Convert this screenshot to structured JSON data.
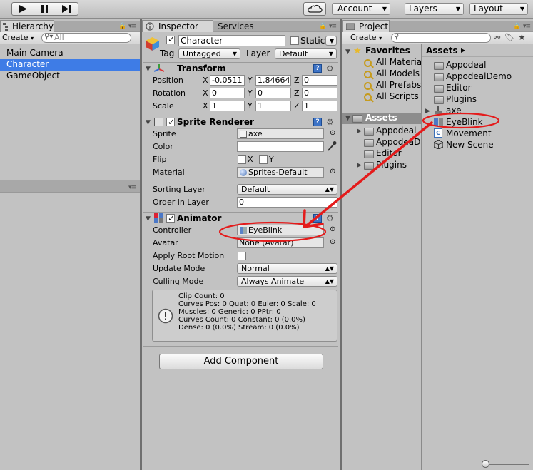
{
  "toolbar": {
    "account_label": "Account",
    "layers_label": "Layers",
    "layout_label": "Layout"
  },
  "hierarchy": {
    "tab_label": "Hierarchy",
    "create_label": "Create",
    "search_placeholder": "All",
    "items": [
      "Main Camera",
      "Character",
      "GameObject"
    ],
    "selected_index": 1
  },
  "inspector": {
    "tab_label": "Inspector",
    "services_tab_label": "Services",
    "object_name": "Character",
    "static_label": "Static",
    "tag_label": "Tag",
    "tag_value": "Untagged",
    "layer_label": "Layer",
    "layer_value": "Default",
    "transform": {
      "title": "Transform",
      "position_label": "Position",
      "rotation_label": "Rotation",
      "scale_label": "Scale",
      "x_label": "X",
      "y_label": "Y",
      "z_label": "Z",
      "position": [
        "-0.0511",
        "1.84664",
        "0"
      ],
      "rotation": [
        "0",
        "0",
        "0"
      ],
      "scale": [
        "1",
        "1",
        "1"
      ]
    },
    "sprite_renderer": {
      "title": "Sprite Renderer",
      "sprite_label": "Sprite",
      "sprite_value": "axe",
      "color_label": "Color",
      "flip_label": "Flip",
      "flip_x_label": "X",
      "flip_y_label": "Y",
      "material_label": "Material",
      "material_value": "Sprites-Default",
      "sorting_layer_label": "Sorting Layer",
      "sorting_layer_value": "Default",
      "order_label": "Order in Layer",
      "order_value": "0"
    },
    "animator": {
      "title": "Animator",
      "controller_label": "Controller",
      "controller_value": "EyeBlink",
      "avatar_label": "Avatar",
      "avatar_value": "None (Avatar)",
      "root_motion_label": "Apply Root Motion",
      "update_mode_label": "Update Mode",
      "update_mode_value": "Normal",
      "culling_mode_label": "Culling Mode",
      "culling_mode_value": "Always Animate",
      "info_lines": [
        "Clip Count: 0",
        "Curves Pos: 0 Quat: 0 Euler: 0 Scale: 0",
        "Muscles: 0 Generic: 0 PPtr: 0",
        "Curves Count: 0 Constant: 0 (0.0%)",
        "Dense: 0 (0.0%) Stream: 0 (0.0%)"
      ]
    },
    "add_component_label": "Add Component"
  },
  "project": {
    "tab_label": "Project",
    "create_label": "Create",
    "favorites_label": "Favorites",
    "favorites": [
      "All Material",
      "All Models",
      "All Prefabs",
      "All Scripts"
    ],
    "assets_label": "Assets",
    "asset_tree": [
      "Appodeal",
      "AppodeaD",
      "Editor",
      "Plugins"
    ],
    "breadcrumb": "Assets",
    "assets": [
      "Appodeal",
      "AppodealDemo",
      "Editor",
      "Plugins",
      "axe",
      "EyeBlink",
      "Movement",
      "New Scene"
    ]
  },
  "colors": {
    "selection": "#3e7ce6",
    "annotation": "#e41b1b",
    "panel": "#c2c2c2"
  }
}
